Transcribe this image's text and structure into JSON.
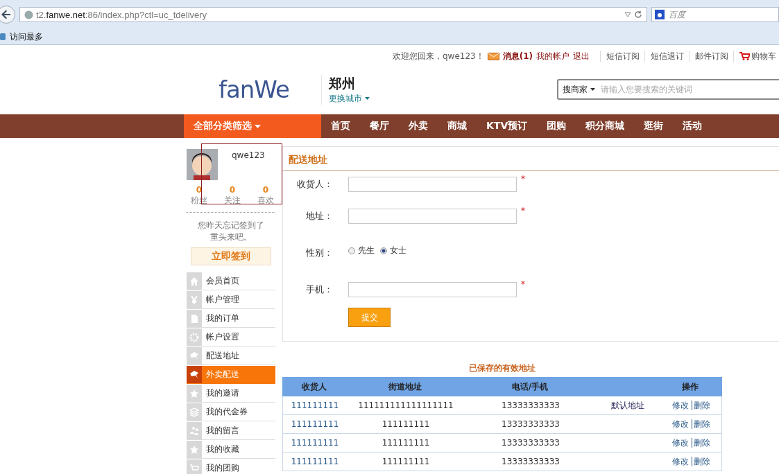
{
  "browser": {
    "url_segments": [
      {
        "text": "t2.",
        "emphasis": false
      },
      {
        "text": "fanwe.net",
        "emphasis": true
      },
      {
        "text": ":86/index.php?ctl=uc_tdelivery",
        "emphasis": false
      }
    ],
    "search_placeholder": "百度",
    "bookmark": "访问最多"
  },
  "topbar": {
    "welcome": "欢迎您回来，qwe123！",
    "messages": "消息(1)",
    "account": "我的帐户",
    "logout": "退出",
    "links": [
      "短信订阅",
      "短信退订",
      "邮件订阅"
    ],
    "cart": "购物车"
  },
  "header": {
    "logo": "fanWe",
    "city": "郑州",
    "change_city": "更换城市",
    "search_scope": "搜商家",
    "search_placeholder": "请输入您要搜索的关键词"
  },
  "nav": {
    "category": "全部分类筛选",
    "items": [
      "首页",
      "餐厅",
      "外卖",
      "商城",
      "KTV预订",
      "团购",
      "积分商城",
      "逛街",
      "活动"
    ]
  },
  "profile": {
    "username": "qwe123",
    "stats": [
      {
        "value": "0",
        "label": "粉丝"
      },
      {
        "value": "0",
        "label": "关注"
      },
      {
        "value": "0",
        "label": "喜欢"
      }
    ],
    "checkin_note": "您昨天忘记签到了重头来吧。",
    "checkin_button": "立即签到"
  },
  "sidebar": {
    "items": [
      {
        "label": "会员首页",
        "selected": false
      },
      {
        "label": "帐户管理",
        "selected": false
      },
      {
        "label": "我的订单",
        "selected": false
      },
      {
        "label": "帐户设置",
        "selected": false
      },
      {
        "label": "配送地址",
        "selected": false
      },
      {
        "label": "外卖配送",
        "selected": true
      },
      {
        "label": "我的邀请",
        "selected": false
      },
      {
        "label": "我的代金券",
        "selected": false
      },
      {
        "label": "我的留言",
        "selected": false
      },
      {
        "label": "我的收藏",
        "selected": false
      },
      {
        "label": "我的团购",
        "selected": false
      }
    ]
  },
  "form": {
    "title": "配送地址",
    "fields": [
      {
        "kind": "text",
        "label": "收货人：",
        "required": true
      },
      {
        "kind": "text",
        "label": "地址：",
        "required": true
      },
      {
        "kind": "radio",
        "label": "性别：",
        "options": [
          {
            "label": "先生",
            "selected": false
          },
          {
            "label": "女士",
            "selected": true
          }
        ]
      },
      {
        "kind": "text",
        "label": "手机：",
        "required": true
      }
    ],
    "required_mark": "*",
    "submit": "提交"
  },
  "table": {
    "title": "已保存的有效地址",
    "columns": [
      "收货人",
      "街道地址",
      "电话/手机",
      "",
      "操作"
    ],
    "rows": [
      {
        "name": "111111111",
        "street": "111111111111111111",
        "phone": "13333333333",
        "default": "默认地址",
        "edit": "修改",
        "delete": "删除"
      },
      {
        "name": "111111111",
        "street": "111111111",
        "phone": "13333333333",
        "edit": "修改",
        "delete": "删除"
      },
      {
        "name": "111111111",
        "street": "111111111",
        "phone": "13333333333",
        "edit": "修改",
        "delete": "删除"
      },
      {
        "name": "111111111",
        "street": "111111111",
        "phone": "13333333333",
        "edit": "修改",
        "delete": "删除"
      }
    ]
  }
}
